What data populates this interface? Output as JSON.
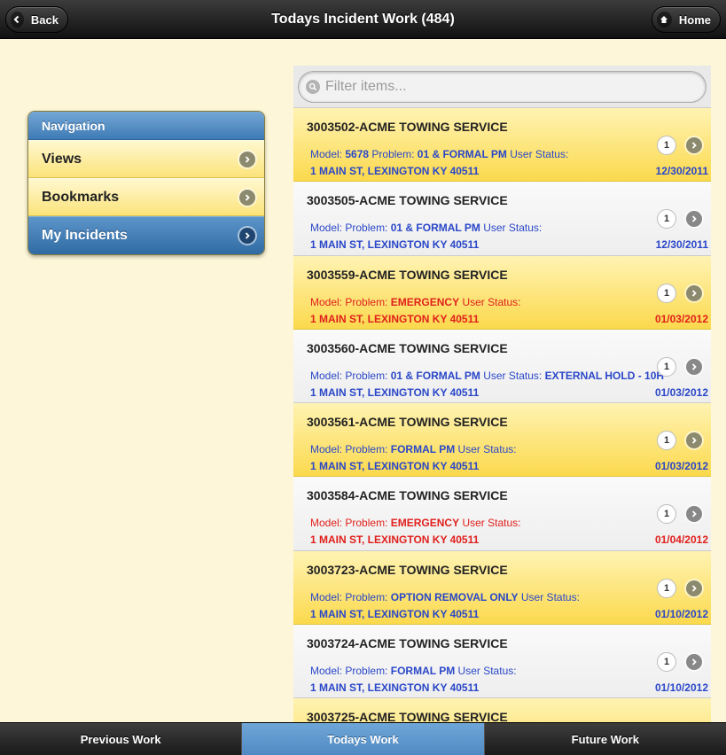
{
  "header": {
    "title": "Todays Incident Work (484)",
    "back_label": "Back",
    "home_label": "Home"
  },
  "navigation": {
    "title": "Navigation",
    "items": [
      {
        "label": "Views"
      },
      {
        "label": "Bookmarks"
      },
      {
        "label": "My Incidents"
      }
    ]
  },
  "filter": {
    "placeholder": "Filter items..."
  },
  "incidents": [
    {
      "title": "3003502-ACME TOWING SERVICE",
      "model_label": "Model:",
      "model": "5678",
      "problem_label": "Problem:",
      "problem": "01 & FORMAL PM",
      "status_label": "User Status:",
      "status": "",
      "address": "1 MAIN ST, LEXINGTON KY 40511",
      "date": "12/30/2011",
      "count": "1"
    },
    {
      "title": "3003505-ACME TOWING SERVICE",
      "model_label": "Model:",
      "model": "",
      "problem_label": "Problem:",
      "problem": "01 & FORMAL PM",
      "status_label": "User Status:",
      "status": "",
      "address": "1 MAIN ST, LEXINGTON KY 40511",
      "date": "12/30/2011",
      "count": "1"
    },
    {
      "title": "3003559-ACME TOWING SERVICE",
      "model_label": "Model:",
      "model": "",
      "problem_label": "Problem:",
      "problem": "EMERGENCY",
      "status_label": "User Status:",
      "status": "",
      "address": "1 MAIN ST, LEXINGTON KY 40511",
      "date": "01/03/2012",
      "count": "1"
    },
    {
      "title": "3003560-ACME TOWING SERVICE",
      "model_label": "Model:",
      "model": "",
      "problem_label": "Problem:",
      "problem": "01 & FORMAL PM",
      "status_label": "User Status:",
      "status": "EXTERNAL HOLD - 10H",
      "address": "1 MAIN ST, LEXINGTON KY 40511",
      "date": "01/03/2012",
      "count": "1"
    },
    {
      "title": "3003561-ACME TOWING SERVICE",
      "model_label": "Model:",
      "model": "",
      "problem_label": "Problem:",
      "problem": "FORMAL PM",
      "status_label": "User Status:",
      "status": "",
      "address": "1 MAIN ST, LEXINGTON KY 40511",
      "date": "01/03/2012",
      "count": "1"
    },
    {
      "title": "3003584-ACME TOWING SERVICE",
      "model_label": "Model:",
      "model": "",
      "problem_label": "Problem:",
      "problem": "EMERGENCY",
      "status_label": "User Status:",
      "status": "",
      "address": "1 MAIN ST, LEXINGTON KY 40511",
      "date": "01/04/2012",
      "count": "1"
    },
    {
      "title": "3003723-ACME TOWING SERVICE",
      "model_label": "Model:",
      "model": "",
      "problem_label": "Problem:",
      "problem": "OPTION REMOVAL ONLY",
      "status_label": "User Status:",
      "status": "",
      "address": "1 MAIN ST, LEXINGTON KY 40511",
      "date": "01/10/2012",
      "count": "1"
    },
    {
      "title": "3003724-ACME TOWING SERVICE",
      "model_label": "Model:",
      "model": "",
      "problem_label": "Problem:",
      "problem": "FORMAL PM",
      "status_label": "User Status:",
      "status": "",
      "address": "1 MAIN ST, LEXINGTON KY 40511",
      "date": "01/10/2012",
      "count": "1"
    },
    {
      "title": "3003725-ACME TOWING SERVICE",
      "model_label": "",
      "model": "",
      "problem_label": "",
      "problem": "",
      "status_label": "",
      "status": "",
      "address": "",
      "date": "",
      "count": ""
    }
  ],
  "footer": {
    "tabs": [
      {
        "label": "Previous Work"
      },
      {
        "label": "Todays Work"
      },
      {
        "label": "Future Work"
      }
    ]
  },
  "colors": {
    "highlight_yellow": "#fbd94d",
    "link_blue": "#2a47c8",
    "emergency_red": "#e0201c",
    "nav_blue": "#3e7bb5"
  }
}
